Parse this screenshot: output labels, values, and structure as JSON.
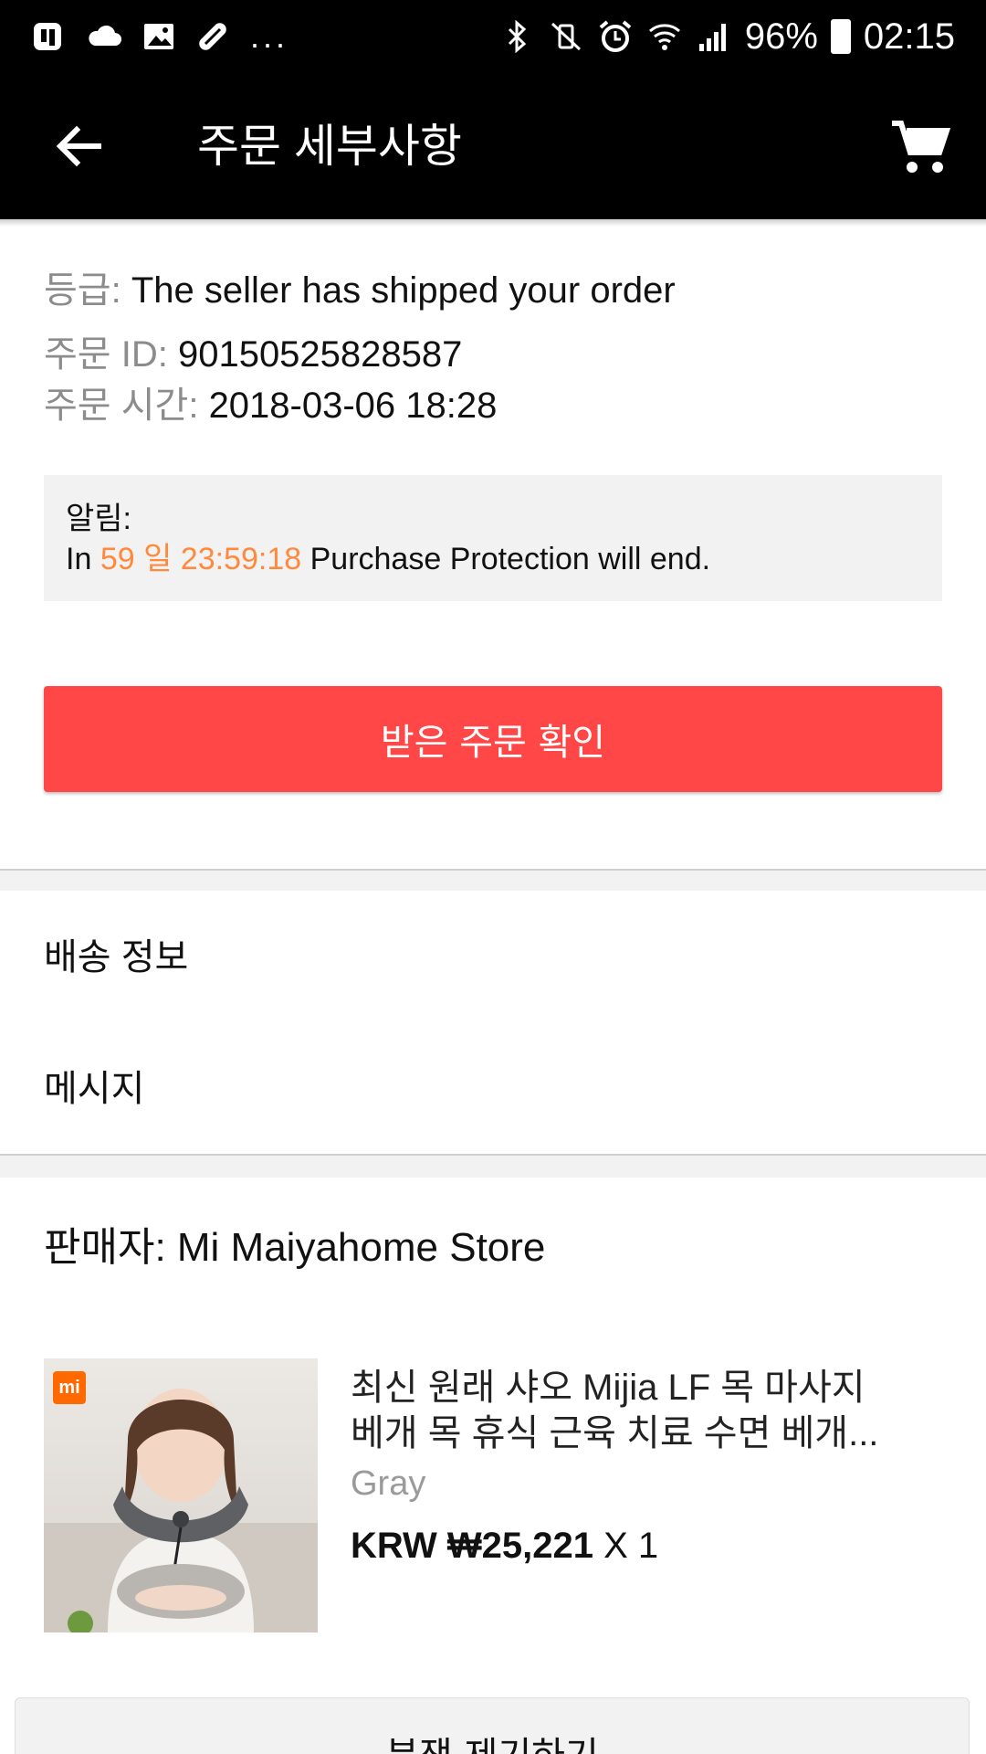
{
  "status_bar": {
    "left_icons": [
      "office-app-icon",
      "cloud-icon",
      "gallery-icon",
      "pill-icon"
    ],
    "more": "...",
    "right_icons": [
      "bluetooth-icon",
      "vibrate-mute-icon",
      "alarm-icon",
      "wifi-icon",
      "signal-icon"
    ],
    "battery": "96%",
    "time": "02:15"
  },
  "app_bar": {
    "title": "주문 세부사항",
    "back_icon": "arrow-left-icon",
    "cart_icon": "shopping-cart-icon"
  },
  "order": {
    "status_label": "등급:",
    "status_value": "The seller has shipped your order",
    "id_label": "주문 ID:",
    "id_value": "90150525828587",
    "time_label": "주문 시간:",
    "time_value": "2018-03-06 18:28"
  },
  "notice": {
    "title": "알림:",
    "prefix": "In",
    "countdown": "59 일 23:59:18",
    "suffix": "Purchase Protection will end."
  },
  "confirm_button": "받은 주문 확인",
  "sections": {
    "shipping_info": "배송 정보",
    "message": "메시지"
  },
  "seller": {
    "label": "판매자:",
    "name": "Mi Maiyahome Store"
  },
  "product": {
    "title_line1": "최신 원래 샤오 Mijia LF 목 마사지",
    "title_line2": "베개 목 휴식 근육 치료 수면 베개...",
    "variant": "Gray",
    "price": "KRW ₩25,221",
    "quantity": "X 1",
    "logo": "mi"
  },
  "dispute_button": "분쟁 제기하기",
  "colors": {
    "accent": "#ff4747",
    "countdown": "#ff8a3d",
    "label_gray": "#8c8c8c"
  }
}
